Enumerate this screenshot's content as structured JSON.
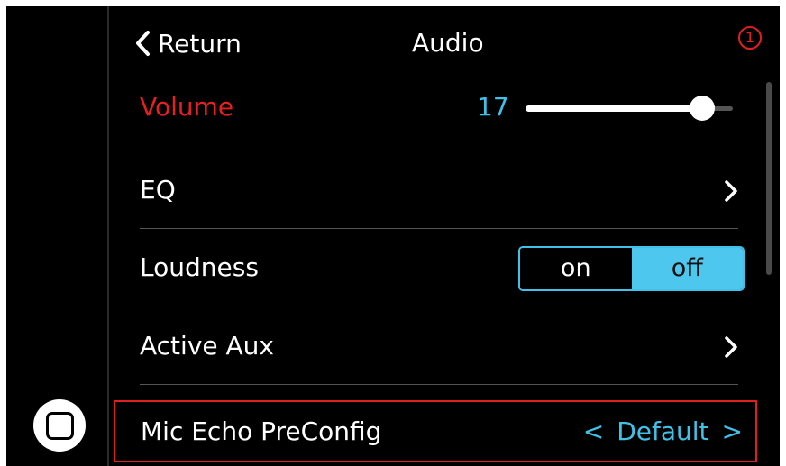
{
  "header": {
    "return_label": "Return",
    "title": "Audio",
    "badge": "1"
  },
  "rows": {
    "volume": {
      "label": "Volume",
      "value": "17",
      "level": 0.85
    },
    "eq": {
      "label": "EQ"
    },
    "loudness": {
      "label": "Loudness",
      "on_label": "on",
      "off_label": "off",
      "selected": "off"
    },
    "active_aux": {
      "label": "Active Aux"
    },
    "mic_echo": {
      "label": "Mic Echo PreConfig",
      "prev": "<",
      "value": "Default",
      "next": ">"
    }
  },
  "colors": {
    "accent": "#3fc1e8",
    "highlight_red": "#e02020",
    "background": "#000000"
  },
  "icons": {
    "home": "home-button-icon",
    "back": "chevron-left-icon",
    "forward": "chevron-right-icon"
  }
}
